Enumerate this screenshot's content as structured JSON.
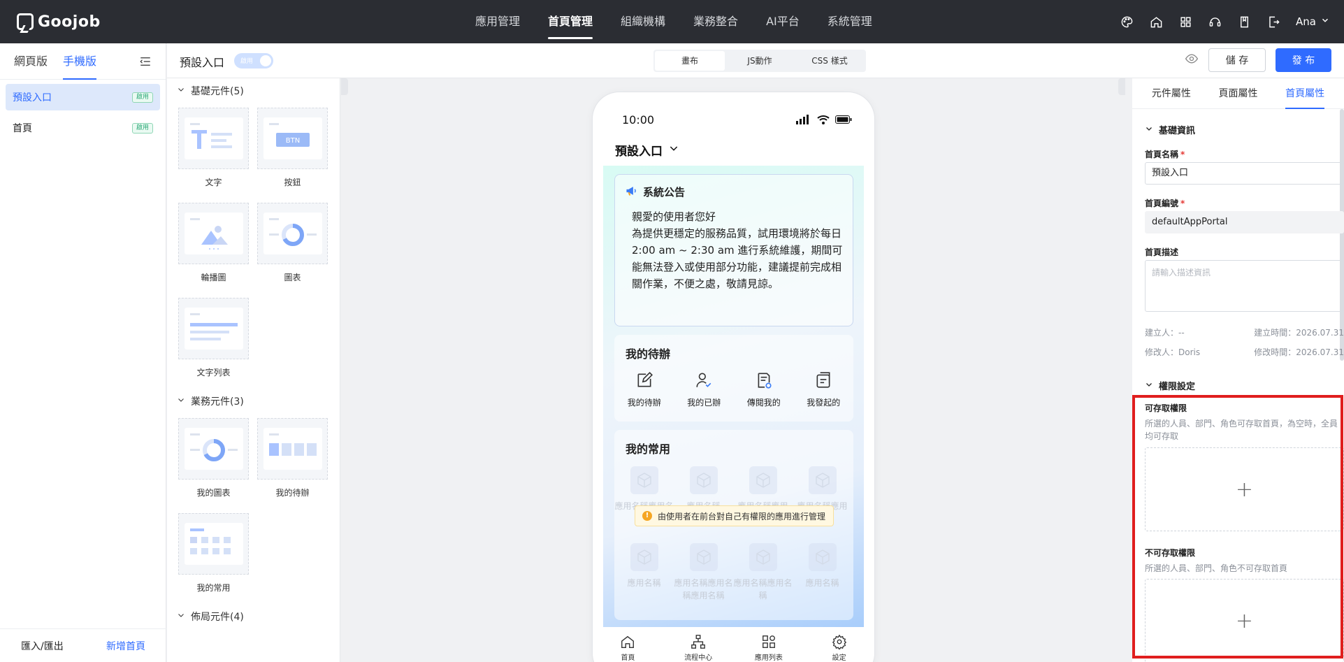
{
  "app": {
    "logo": "Goojob"
  },
  "topnav": {
    "items": [
      "應用管理",
      "首頁管理",
      "組織機構",
      "業務整合",
      "AI平台",
      "系統管理"
    ],
    "active_index": 1
  },
  "top_right": {
    "icons": [
      "palette-icon",
      "home-icon",
      "apps-grid-icon",
      "support-icon",
      "book-icon",
      "export-icon"
    ],
    "user": "Ana"
  },
  "left_panel": {
    "tabs": [
      "網頁版",
      "手機版"
    ],
    "active_tab": 1,
    "pages": [
      {
        "name": "預設入口",
        "badge": "啟用"
      },
      {
        "name": "首頁",
        "badge": "啟用"
      }
    ],
    "footer": {
      "import_export": "匯入/匯出",
      "add_page": "新增首頁"
    }
  },
  "editor_bar": {
    "title": "預設入口",
    "toggle_label": "啟用",
    "segments": [
      "畫布",
      "JS動作",
      "CSS 樣式"
    ],
    "active_segment": 0,
    "save_label": "儲 存",
    "publish_label": "發 布"
  },
  "palette": {
    "sections": [
      {
        "title": "基礎元件(5)",
        "items": [
          "文字",
          "按鈕",
          "輪播圖",
          "圖表",
          "文字列表"
        ]
      },
      {
        "title": "業務元件(3)",
        "items": [
          "我的圖表",
          "我的待辦",
          "我的常用"
        ]
      },
      {
        "title": "佈局元件(4)",
        "items": []
      }
    ],
    "thumb_texts": {
      "btn": "BTN"
    }
  },
  "phone": {
    "time": "10:00",
    "portal_name": "預設入口",
    "notice": {
      "title": "系統公告",
      "lines": [
        "親愛的使用者您好",
        "為提供更穩定的服務品質，試用環境將於每日2:00 am ~ 2:30 am 進行系統維護，期間可能無法登入或使用部分功能，建議提前完成相關作業，不便之處，敬請見諒。"
      ]
    },
    "todo": {
      "title": "我的待辦",
      "items": [
        "我的待辦",
        "我的已辦",
        "傳閱我的",
        "我發起的"
      ]
    },
    "common": {
      "title": "我的常用",
      "apps": [
        "應用名稱應用名稱",
        "應用名稱",
        "應用名稱應用",
        "應用名稱應用",
        "應用名稱",
        "應用名稱應用名稱應用名稱",
        "應用名稱應用名稱",
        "應用名稱"
      ],
      "tip": "由使用者在前台對自己有權限的應用進行管理",
      "tip_icon": "!"
    },
    "tabbar": [
      "首頁",
      "流程中心",
      "應用列表",
      "設定"
    ]
  },
  "right_panel": {
    "tabs": [
      "元件屬性",
      "頁面屬性",
      "首頁屬性"
    ],
    "active_tab": 2,
    "basic": {
      "title": "基礎資訊",
      "name_label": "首頁名稱",
      "name_value": "預設入口",
      "code_label": "首頁編號",
      "code_value": "defaultAppPortal",
      "desc_label": "首頁描述",
      "desc_placeholder": "請輸入描述資訊",
      "creator": "建立人：--",
      "created": "建立時間：2026.07.31",
      "modifier": "修改人：Doris",
      "modified": "修改時間：2026.07.31"
    },
    "perm": {
      "title": "權限設定",
      "allow_label": "可存取權限",
      "allow_desc": "所選的人員、部門、角色可存取首頁，為空時，全員均可存取",
      "deny_label": "不可存取權限",
      "deny_desc": "所選的人員、部門、角色不可存取首頁",
      "add_symbol": "+"
    }
  },
  "colors": {
    "primary": "#2f6bff",
    "topbar": "#2b2d33",
    "highlight": "#e01e1e"
  }
}
